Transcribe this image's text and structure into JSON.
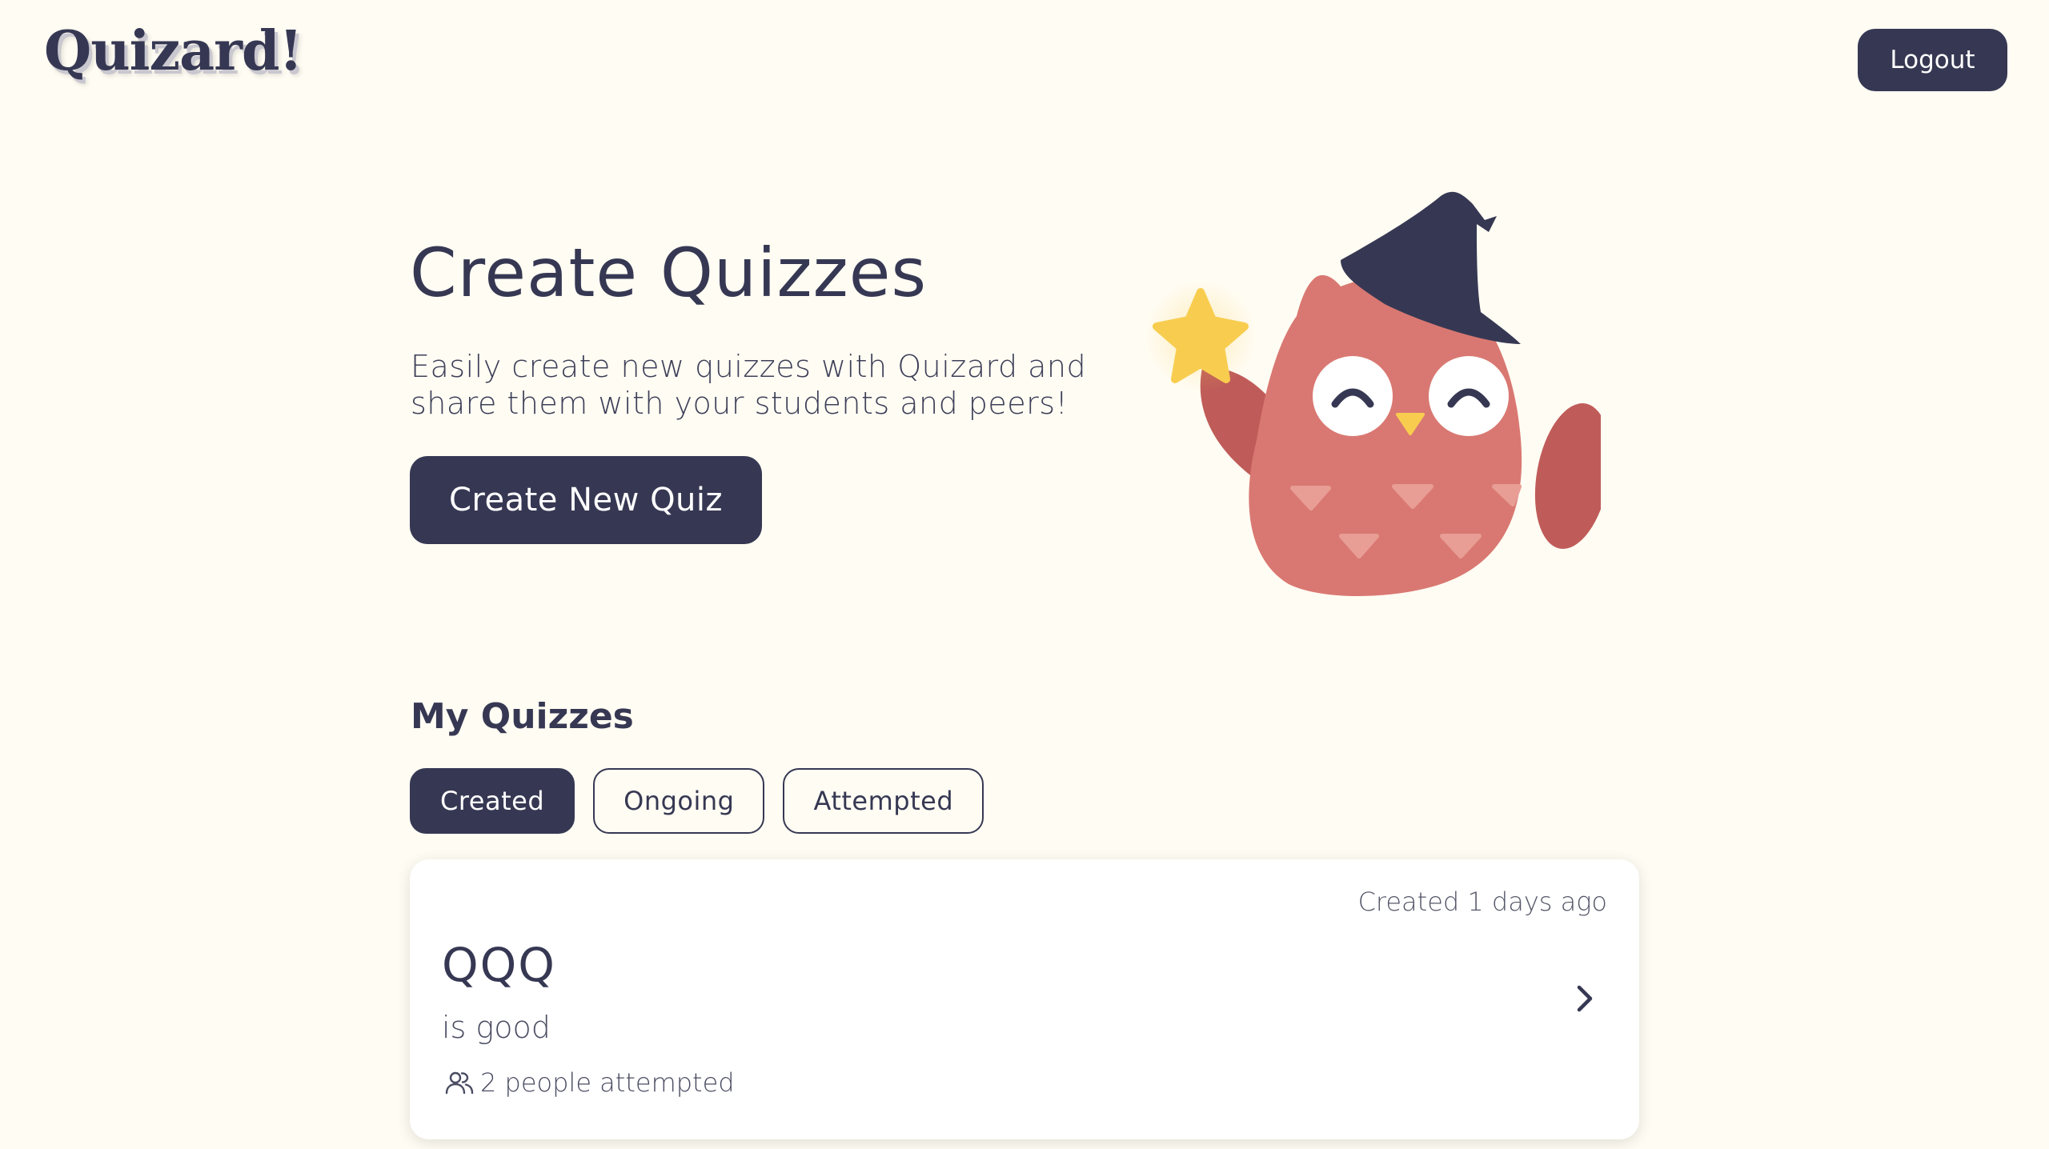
{
  "header": {
    "logo_text": "Quizard!",
    "logout_label": "Logout"
  },
  "hero": {
    "title": "Create Quizzes",
    "subtitle": "Easily create new quizzes with Quizard and share them with your students and peers!",
    "cta_label": "Create New Quiz"
  },
  "my_quizzes": {
    "title": "My Quizzes",
    "tabs": [
      {
        "label": "Created",
        "active": true
      },
      {
        "label": "Ongoing",
        "active": false
      },
      {
        "label": "Attempted",
        "active": false
      }
    ],
    "quizzes": [
      {
        "title": "QQQ",
        "description": "is good",
        "created": "Created 1 days ago",
        "attempts": "2 people attempted"
      }
    ]
  },
  "icons": {
    "illustration": "wizard-owl-illustration",
    "attempts": "people-icon",
    "open": "chevron-right-icon"
  },
  "colors": {
    "background": "#fffcf3",
    "primary": "#363853",
    "owl_body": "#d97872",
    "owl_wing": "#bf5c59",
    "star": "#f8cd4f"
  }
}
